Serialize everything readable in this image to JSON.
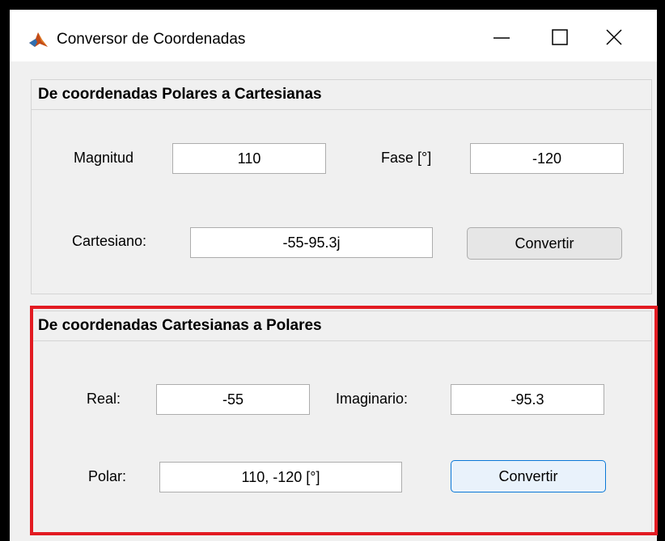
{
  "window": {
    "title": "Conversor de Coordenadas",
    "app_icon": "matlab-icon",
    "controls": [
      "minimize-icon",
      "maximize-icon",
      "close-icon"
    ]
  },
  "polar_to_cartesian": {
    "title": "De coordenadas Polares a Cartesianas",
    "magnitude_label": "Magnitud",
    "magnitude_value": "110",
    "phase_label": "Fase [°]",
    "phase_value": "-120",
    "cartesian_label": "Cartesiano:",
    "cartesian_value": "-55-95.3j",
    "convert_label": "Convertir"
  },
  "cartesian_to_polar": {
    "title": "De coordenadas Cartesianas a Polares",
    "real_label": "Real:",
    "real_value": "-55",
    "imag_label": "Imaginario:",
    "imag_value": "-95.3",
    "polar_label": "Polar:",
    "polar_value": "110, -120 [°]",
    "convert_label": "Convertir"
  },
  "colors": {
    "highlight": "#e21b22",
    "focus_border": "#0a78d7",
    "background": "#f0f0f0"
  }
}
